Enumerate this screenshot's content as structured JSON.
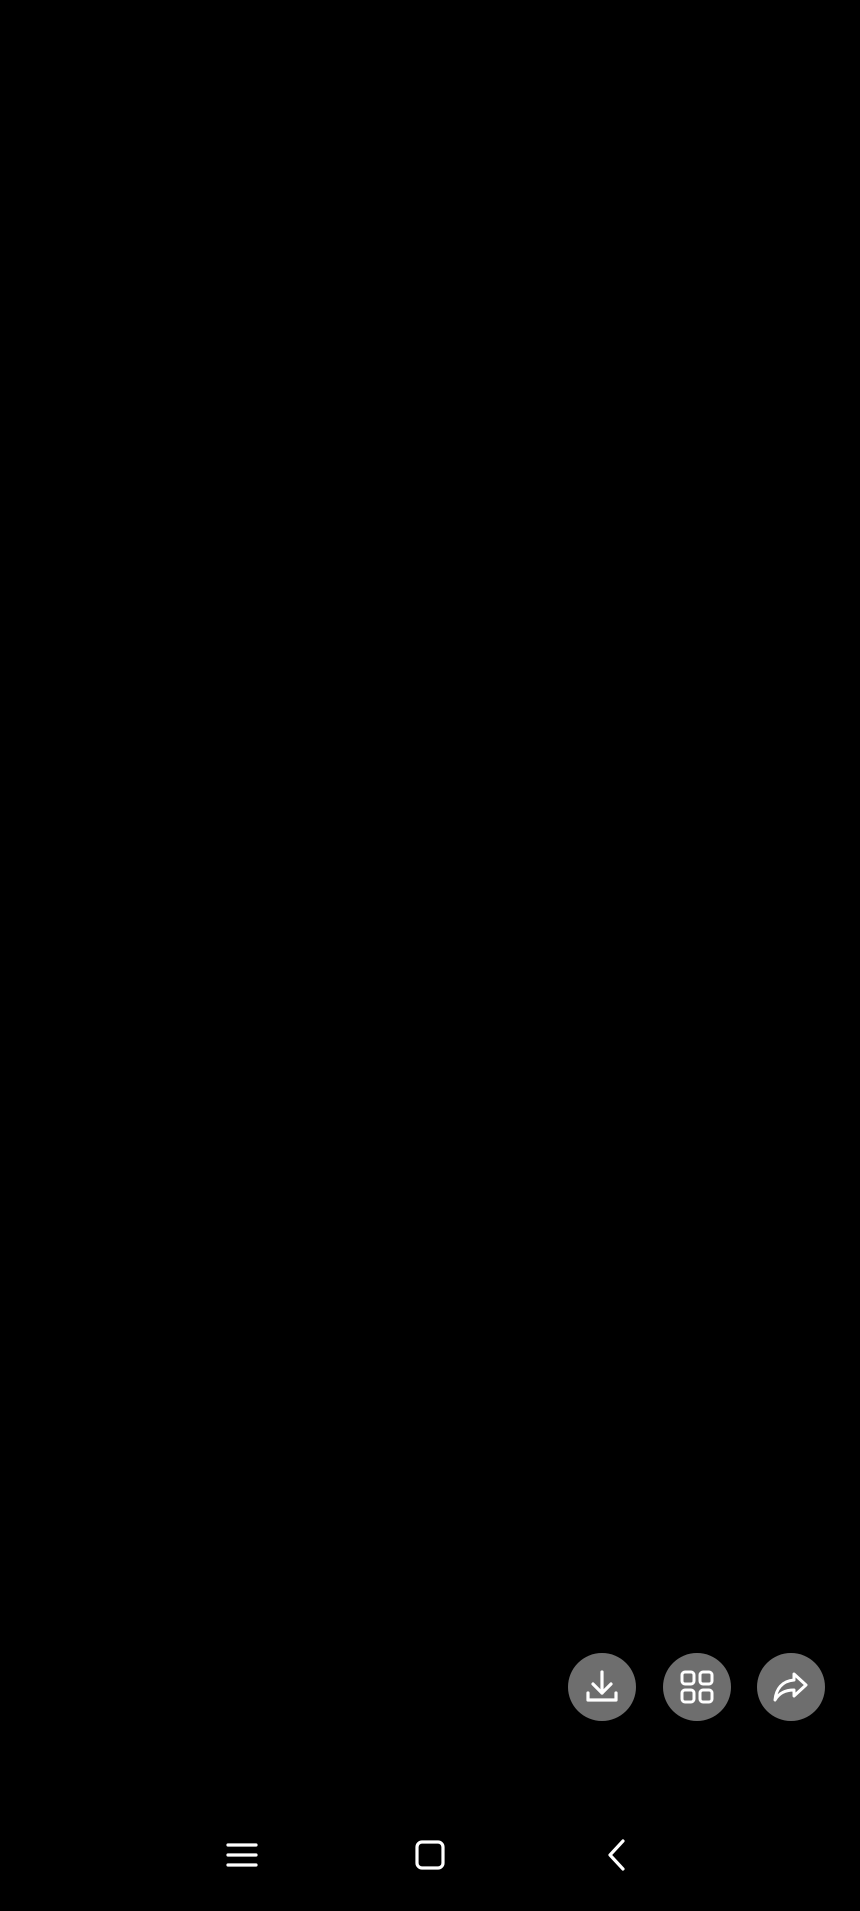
{
  "screen": {
    "background_color": "#000000"
  },
  "action_buttons": [
    {
      "id": "download",
      "icon": "download-icon"
    },
    {
      "id": "grid",
      "icon": "grid-icon"
    },
    {
      "id": "share",
      "icon": "share-forward-icon"
    }
  ],
  "action_button_color": "#6e6e6e",
  "icon_color": "#ffffff",
  "navigation_bar": {
    "buttons": [
      {
        "id": "recents",
        "icon": "menu-lines-icon"
      },
      {
        "id": "home",
        "icon": "square-home-icon"
      },
      {
        "id": "back",
        "icon": "chevron-left-icon"
      }
    ]
  }
}
